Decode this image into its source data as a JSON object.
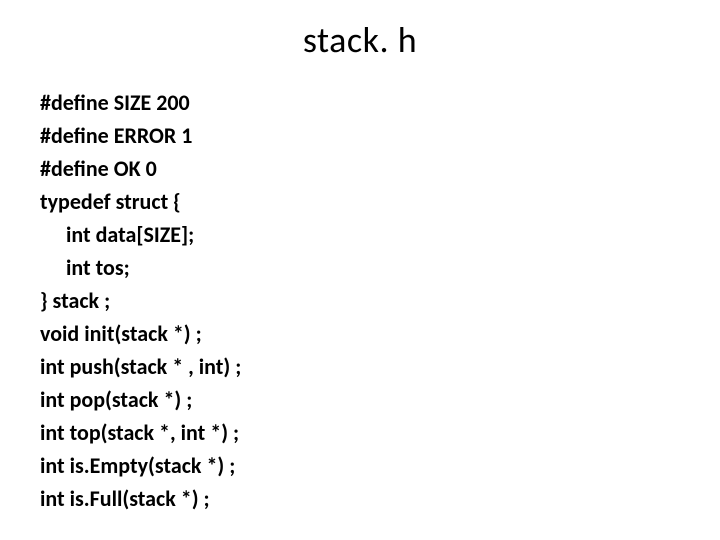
{
  "title": "stack. h",
  "lines": [
    {
      "text": "#define SIZE 200",
      "indent": false
    },
    {
      "text": "#define ERROR 1",
      "indent": false
    },
    {
      "text": "#define OK 0",
      "indent": false
    },
    {
      "text": "typedef struct {",
      "indent": false
    },
    {
      "text": "int data[SIZE];",
      "indent": true
    },
    {
      "text": "int tos;",
      "indent": true
    },
    {
      "text": "} stack ;",
      "indent": false
    },
    {
      "text": "void init(stack *) ;",
      "indent": false
    },
    {
      "text": "int push(stack * , int) ;",
      "indent": false
    },
    {
      "text": "int pop(stack *) ;",
      "indent": false
    },
    {
      "text": "int top(stack *, int *) ;",
      "indent": false
    },
    {
      "text": "int is.Empty(stack *) ;",
      "indent": false
    },
    {
      "text": "int is.Full(stack *) ;",
      "indent": false
    }
  ]
}
